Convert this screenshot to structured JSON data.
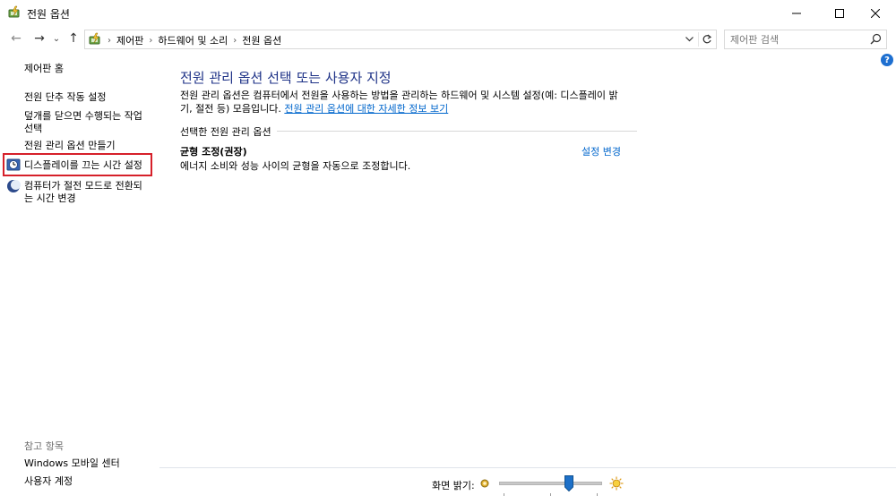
{
  "window": {
    "title": "전원 옵션",
    "minimize_icon": "minimize-icon",
    "maximize_icon": "maximize-icon",
    "close_icon": "close-icon"
  },
  "nav": {
    "back_glyph": "←",
    "forward_glyph": "→",
    "recent_glyph": "⌄",
    "up_glyph": "↑"
  },
  "address": {
    "crumbs": [
      "제어판",
      "하드웨어 및 소리",
      "전원 옵션"
    ],
    "separator": "›"
  },
  "search": {
    "placeholder": "제어판 검색"
  },
  "help": {
    "label": "?"
  },
  "sidebar": {
    "home": "제어판 홈",
    "items": [
      {
        "label": "전원 단추 작동 설정"
      },
      {
        "label": "덮개를 닫으면 수행되는 작업",
        "label2": "선택"
      },
      {
        "label": "전원 관리 옵션 만들기"
      },
      {
        "label": "디스플레이를 끄는 시간 설정",
        "icon": "clock-icon",
        "highlighted": true
      },
      {
        "label": "컴퓨터가 절전 모드로 전환되",
        "label2": "는 시간 변경",
        "icon": "moon-icon"
      }
    ],
    "see_also": "참고 항목",
    "see_also_items": [
      "Windows 모바일 센터",
      "사용자 계정"
    ]
  },
  "main": {
    "title": "전원 관리 옵션 선택 또는 사용자 지정",
    "desc_line1": "전원 관리 옵션은 컴퓨터에서 전원을 사용하는 방법을 관리하는 하드웨어 및 시스템 설정(예: 디스플레이 밝",
    "desc_line2_prefix": "기, 절전 등) 모음입니다. ",
    "desc_link": "전원 관리 옵션에 대한 자세한 정보 보기",
    "section_label": "선택한 전원 관리 옵션",
    "plan_name": "균형 조정(권장)",
    "plan_desc": "에너지 소비와 성능 사이의 균형을 자동으로 조정합니다.",
    "plan_change": "설정 변경"
  },
  "brightness": {
    "label": "화면 밝기:",
    "level": 0.65
  },
  "colors": {
    "title_blue": "#1e3287",
    "link_blue": "#0066cc",
    "highlight_red": "#d6202a"
  }
}
